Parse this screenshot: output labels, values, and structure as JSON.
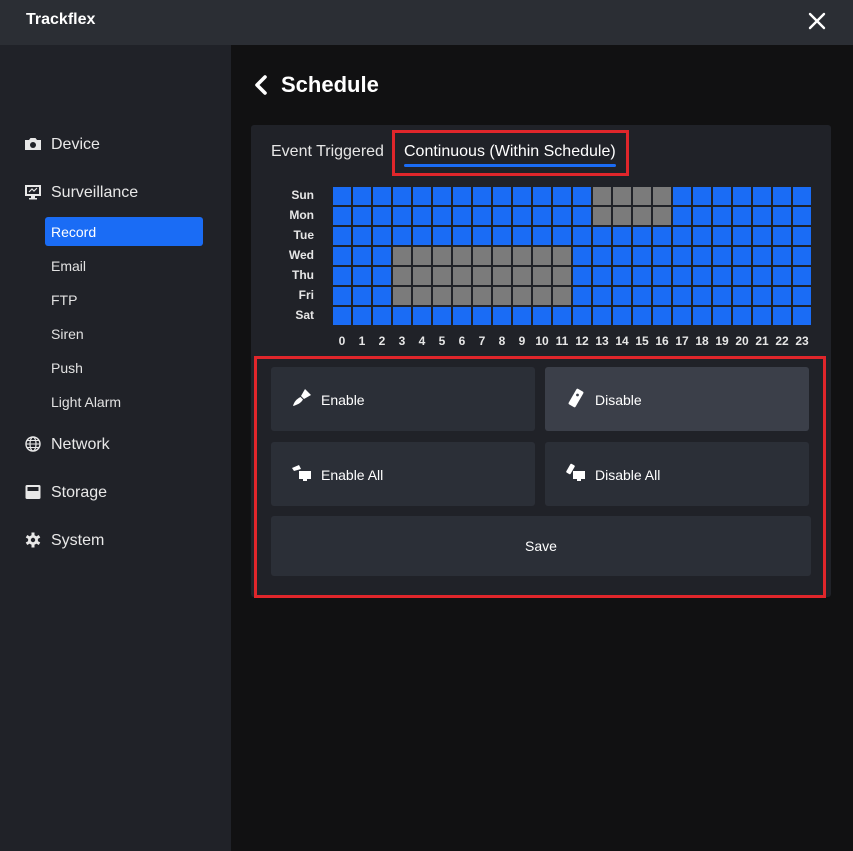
{
  "app": {
    "title": "Trackflex"
  },
  "sidebar": {
    "groups": [
      {
        "label": "Device",
        "icon": "camera-icon"
      },
      {
        "label": "Surveillance",
        "icon": "monitor-icon"
      },
      {
        "label": "Network",
        "icon": "globe-icon"
      },
      {
        "label": "Storage",
        "icon": "drive-icon"
      },
      {
        "label": "System",
        "icon": "gear-icon"
      }
    ],
    "surveillance_items": [
      {
        "label": "Record",
        "active": true
      },
      {
        "label": "Email"
      },
      {
        "label": "FTP"
      },
      {
        "label": "Siren"
      },
      {
        "label": "Push"
      },
      {
        "label": "Light Alarm"
      }
    ]
  },
  "page": {
    "title": "Schedule"
  },
  "tabs": {
    "event": "Event Triggered",
    "continuous": "Continuous (Within Schedule)",
    "active": "continuous"
  },
  "schedule": {
    "days": [
      "Sun",
      "Mon",
      "Tue",
      "Wed",
      "Thu",
      "Fri",
      "Sat"
    ],
    "hours": [
      "0",
      "1",
      "2",
      "3",
      "4",
      "5",
      "6",
      "7",
      "8",
      "9",
      "10",
      "11",
      "12",
      "13",
      "14",
      "15",
      "16",
      "17",
      "18",
      "19",
      "20",
      "21",
      "22",
      "23"
    ],
    "enabled": [
      [
        1,
        1,
        1,
        1,
        1,
        1,
        1,
        1,
        1,
        1,
        1,
        1,
        1,
        0,
        0,
        0,
        0,
        1,
        1,
        1,
        1,
        1,
        1,
        1
      ],
      [
        1,
        1,
        1,
        1,
        1,
        1,
        1,
        1,
        1,
        1,
        1,
        1,
        1,
        0,
        0,
        0,
        0,
        1,
        1,
        1,
        1,
        1,
        1,
        1
      ],
      [
        1,
        1,
        1,
        1,
        1,
        1,
        1,
        1,
        1,
        1,
        1,
        1,
        1,
        1,
        1,
        1,
        1,
        1,
        1,
        1,
        1,
        1,
        1,
        1
      ],
      [
        1,
        1,
        1,
        0,
        0,
        0,
        0,
        0,
        0,
        0,
        0,
        0,
        1,
        1,
        1,
        1,
        1,
        1,
        1,
        1,
        1,
        1,
        1,
        1
      ],
      [
        1,
        1,
        1,
        0,
        0,
        0,
        0,
        0,
        0,
        0,
        0,
        0,
        1,
        1,
        1,
        1,
        1,
        1,
        1,
        1,
        1,
        1,
        1,
        1
      ],
      [
        1,
        1,
        1,
        0,
        0,
        0,
        0,
        0,
        0,
        0,
        0,
        0,
        1,
        1,
        1,
        1,
        1,
        1,
        1,
        1,
        1,
        1,
        1,
        1
      ],
      [
        1,
        1,
        1,
        1,
        1,
        1,
        1,
        1,
        1,
        1,
        1,
        1,
        1,
        1,
        1,
        1,
        1,
        1,
        1,
        1,
        1,
        1,
        1,
        1
      ]
    ],
    "colors": {
      "enabled": "#1a6cf5",
      "disabled": "#7b7b7b"
    }
  },
  "actions": {
    "enable": "Enable",
    "disable": "Disable",
    "enable_all": "Enable All",
    "disable_all": "Disable All",
    "save": "Save"
  },
  "colors": {
    "accent": "#1a6cf5",
    "highlight": "#e0262b"
  }
}
